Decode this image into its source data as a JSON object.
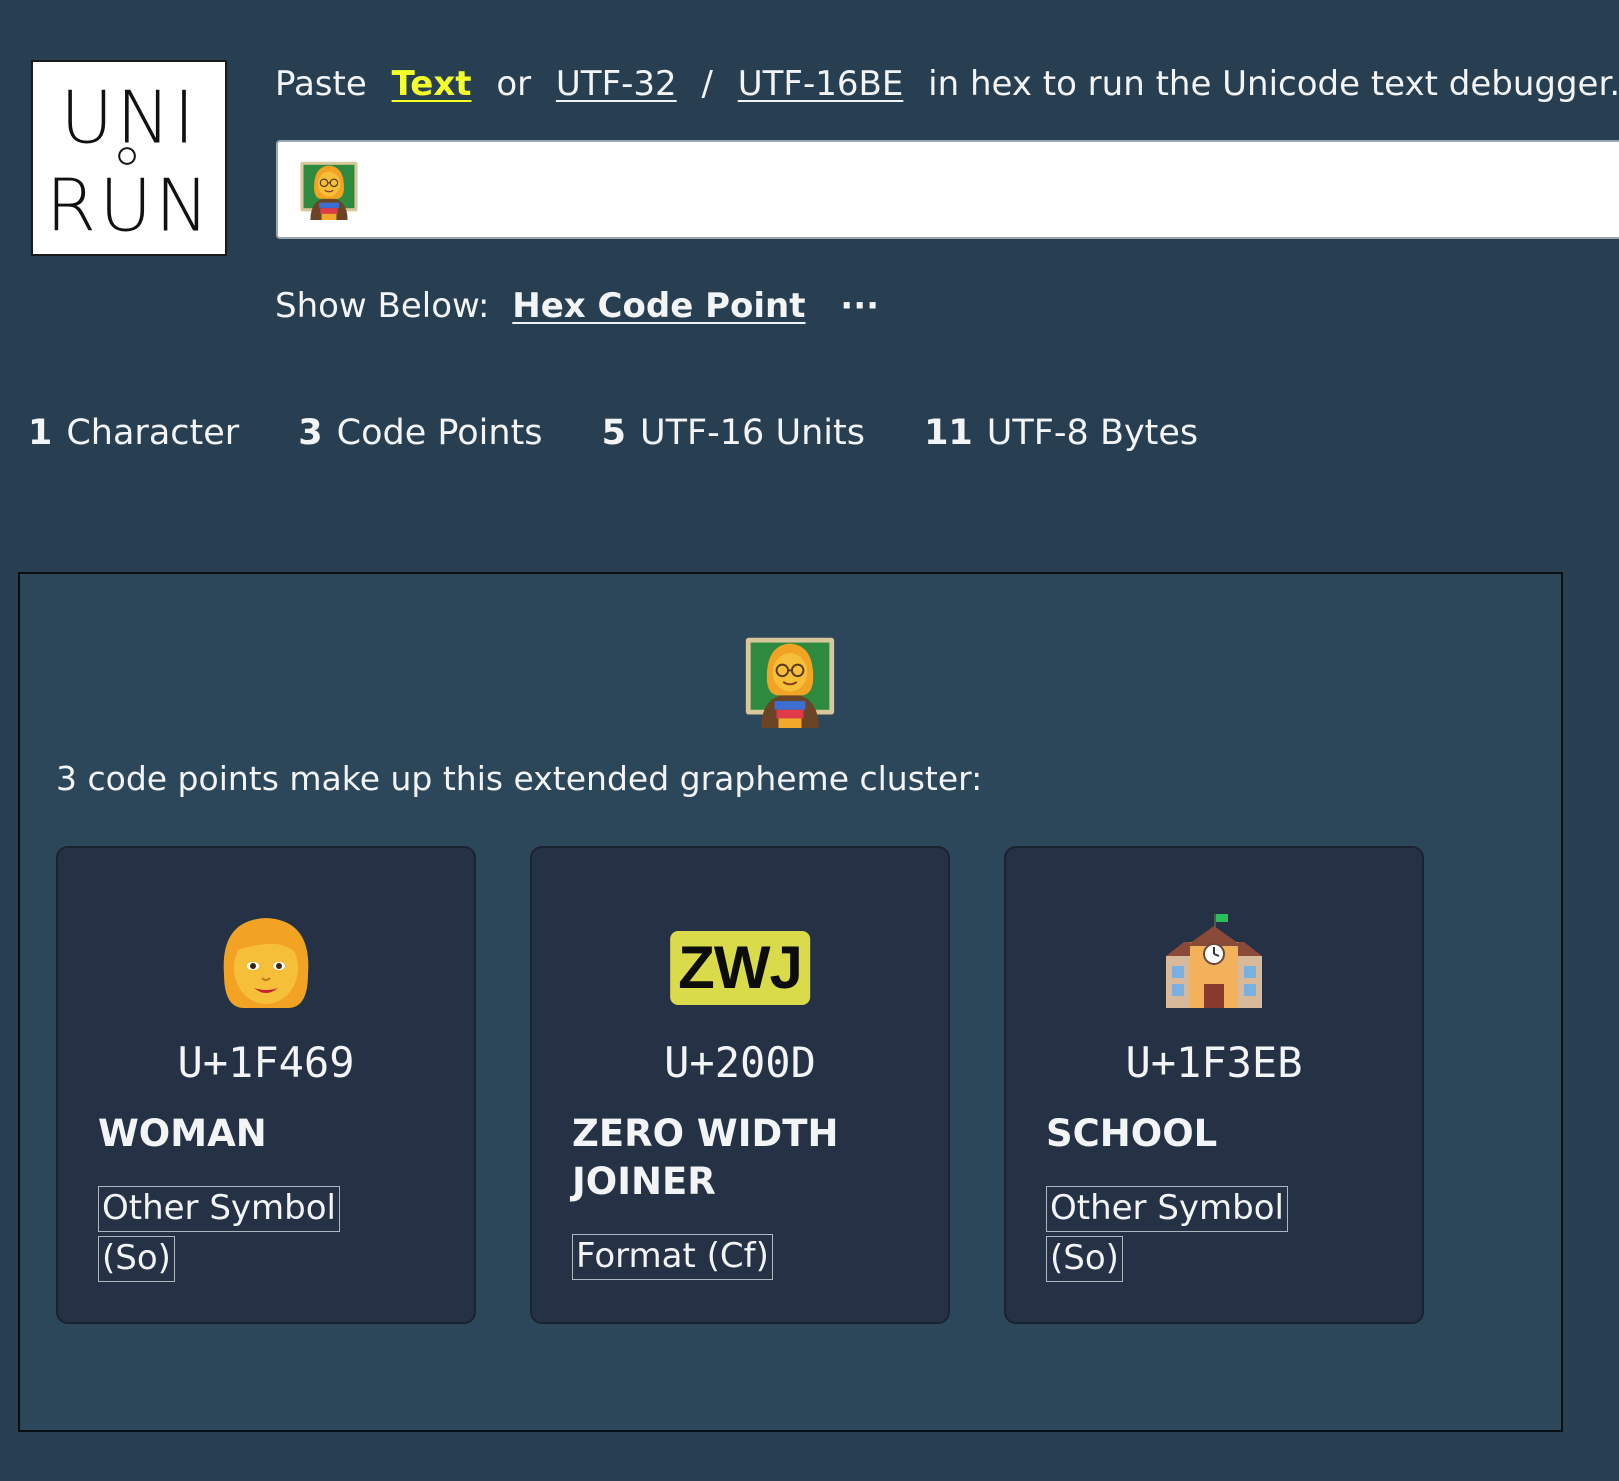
{
  "logo": {
    "line1": "UNI",
    "line2": "RUN"
  },
  "intro": {
    "prefix": "Paste",
    "text_link": "Text",
    "or": "or",
    "utf32_link": "UTF-32",
    "slash": "/",
    "utf16_link": "UTF-16BE",
    "suffix": "in hex to run the Unicode text debugger."
  },
  "input": {
    "value_icon": "woman-teacher-emoji"
  },
  "show_below": {
    "label": "Show Below:",
    "mode": "Hex Code Point",
    "more": "···"
  },
  "stats": [
    {
      "num": "1",
      "label": "Character"
    },
    {
      "num": "3",
      "label": "Code Points"
    },
    {
      "num": "5",
      "label": "UTF-16 Units"
    },
    {
      "num": "11",
      "label": "UTF-8 Bytes"
    }
  ],
  "cluster": {
    "glyph_icon": "woman-teacher-emoji",
    "description": "3 code points make up this extended grapheme cluster:",
    "code_points": [
      {
        "glyph_icon": "woman-emoji",
        "codepoint": "U+1F469",
        "name": "WOMAN",
        "category": "Other Symbol (So)"
      },
      {
        "glyph_text": "ZWJ",
        "codepoint": "U+200D",
        "name": "ZERO WIDTH JOINER",
        "category": "Format (Cf)"
      },
      {
        "glyph_icon": "school-emoji",
        "codepoint": "U+1F3EB",
        "name": "SCHOOL",
        "category": "Other Symbol (So)"
      }
    ]
  },
  "colors": {
    "background": "#283f52",
    "panel": "#2c465a",
    "card": "#253245",
    "active_link": "#f4ff2a",
    "zwj_badge": "#d9db4a"
  }
}
